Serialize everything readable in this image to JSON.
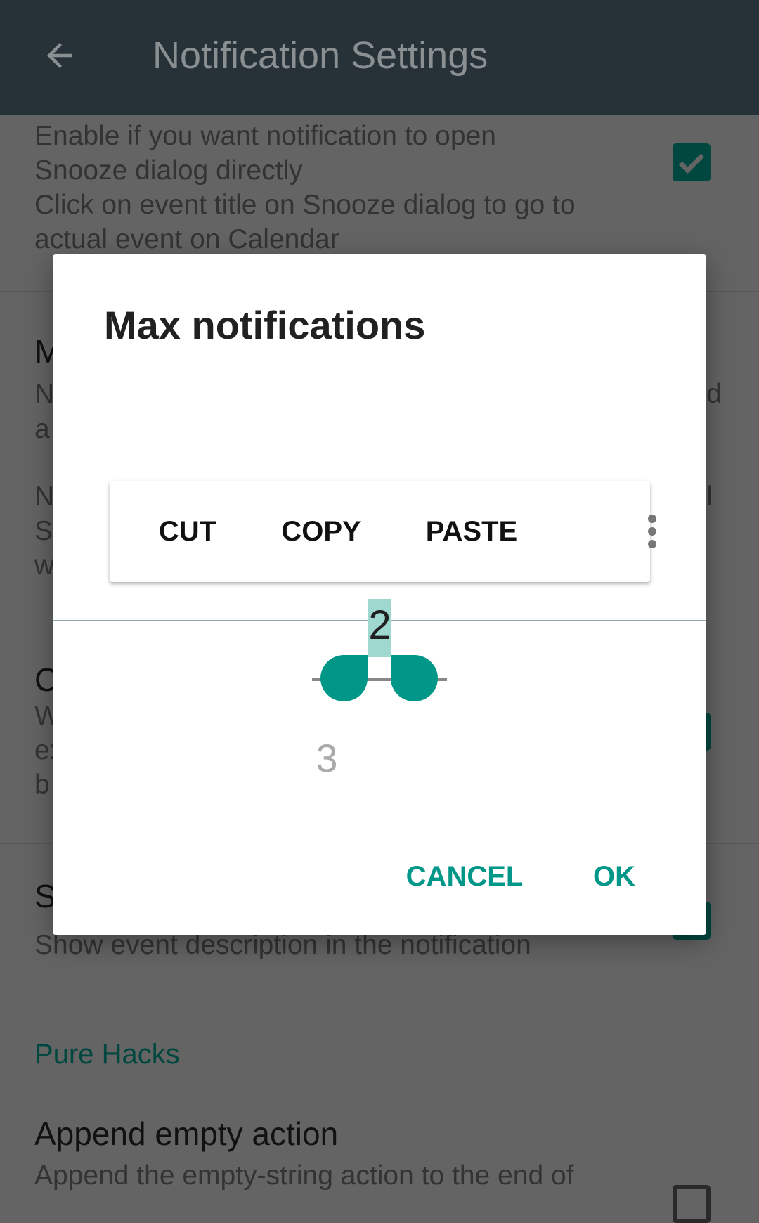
{
  "header": {
    "title": "Notification Settings",
    "back_icon": "arrow-left-icon"
  },
  "background": {
    "item1_lines": [
      "Enable if you want notification to open",
      "Snooze dialog directly",
      "Click on event title on Snooze dialog to go to",
      "actual event on Calendar"
    ],
    "item1_checked": true,
    "fragments": [
      "M",
      "N",
      "d",
      "a",
      "N",
      "l",
      "S",
      "w",
      "C",
      "W",
      "ex",
      "b",
      "S"
    ],
    "show_desc_summary": "Show event description in the notification",
    "section": "Pure Hacks",
    "append_title": "Append empty action",
    "append_summary": "Append the empty-string action to the end of",
    "append_checked": false,
    "accent": "#00473f"
  },
  "dialog": {
    "title": "Max notifications",
    "context_menu": {
      "cut": "CUT",
      "copy": "COPY",
      "paste": "PASTE",
      "more_icon": "more-vert-icon"
    },
    "picker": {
      "selected": "2",
      "next": "3"
    },
    "cancel": "CANCEL",
    "ok": "OK",
    "accent": "#009688"
  }
}
